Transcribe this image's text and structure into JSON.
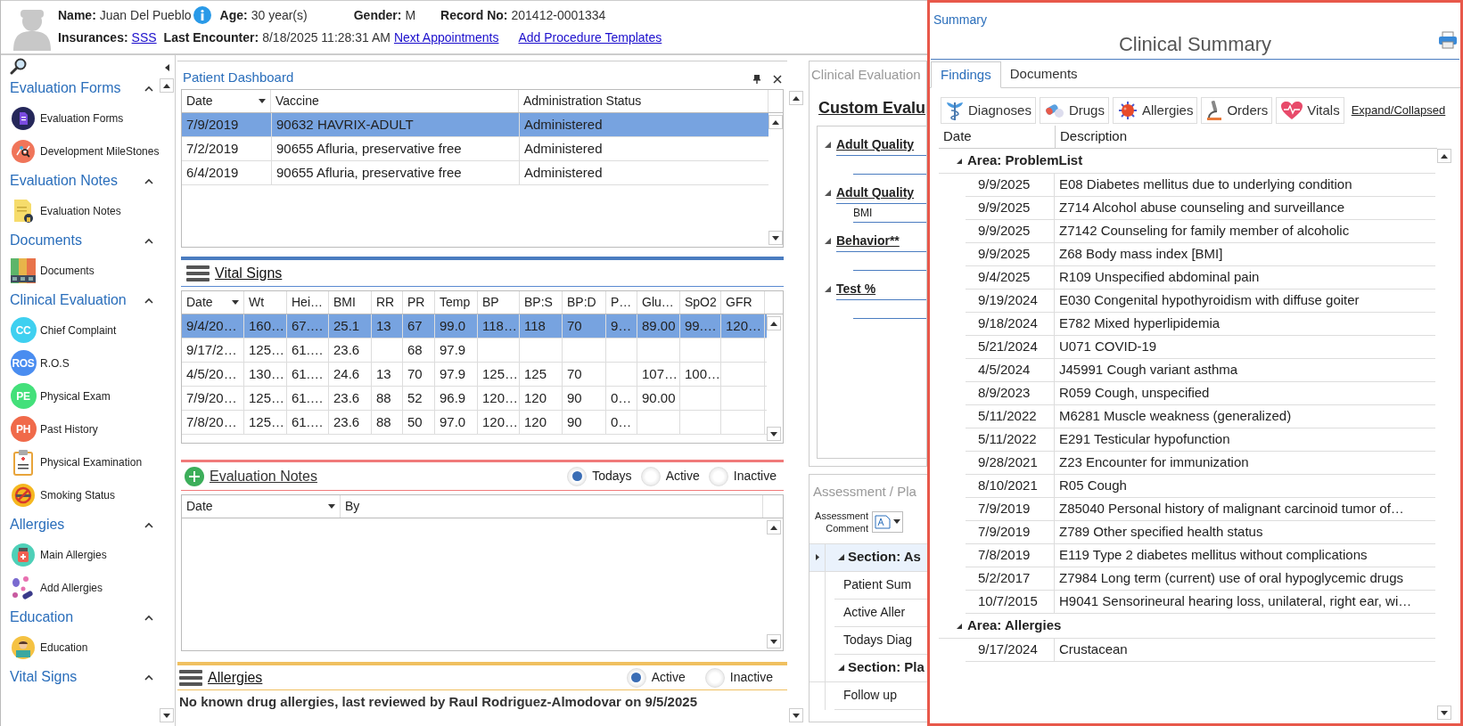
{
  "patient": {
    "row_1": [
      {
        "label": "Name:",
        "value": "Juan Del Pueblo",
        "info": true,
        "link": false
      },
      {
        "label": "Age:",
        "value": "30 year(s)",
        "link": false
      },
      {
        "label": "Gender:",
        "value": "M",
        "link": false
      },
      {
        "label": "Record No:",
        "value": "201412-0001334",
        "link": false
      }
    ],
    "row_2": [
      {
        "label": "Insurances:",
        "value": "SSS",
        "link": true
      },
      {
        "label": "Last Encounter:",
        "value": "8/18/2025 11:28:31 AM",
        "link": false
      }
    ],
    "links": [
      "Next Appointments",
      "Add Procedure Templates"
    ]
  },
  "sidebar": {
    "groups": [
      {
        "title": "Evaluation Forms",
        "expanded": true,
        "items": [
          {
            "label": "Evaluation Forms"
          },
          {
            "label": "Development MileStones"
          }
        ]
      },
      {
        "title": "Evaluation Notes",
        "expanded": true,
        "items": [
          {
            "label": "Evaluation Notes"
          }
        ]
      },
      {
        "title": "Documents",
        "expanded": true,
        "items": [
          {
            "label": "Documents"
          }
        ]
      },
      {
        "title": "Clinical Evaluation",
        "expanded": true,
        "items": [
          {
            "label": "Chief Complaint",
            "badge": "CC"
          },
          {
            "label": "R.O.S",
            "badge": "ROS"
          },
          {
            "label": "Physical Exam",
            "badge": "PE"
          },
          {
            "label": "Past History",
            "badge": "PH"
          },
          {
            "label": "Physical Examination"
          },
          {
            "label": "Smoking Status"
          }
        ]
      },
      {
        "title": "Allergies",
        "expanded": true,
        "items": [
          {
            "label": "Main Allergies"
          },
          {
            "label": "Add Allergies"
          }
        ]
      },
      {
        "title": "Education",
        "expanded": true,
        "items": [
          {
            "label": "Education"
          }
        ]
      },
      {
        "title": "Vital Signs",
        "expanded": true
      }
    ]
  },
  "dashboard": {
    "title": "Patient Dashboard",
    "vaccines": {
      "columns": [
        "Date",
        "Vaccine",
        "Administration Status"
      ],
      "rows": [
        {
          "cells": [
            "7/9/2019",
            "90632 HAVRIX-ADULT",
            "Administered"
          ],
          "selected": true
        },
        {
          "cells": [
            "7/2/2019",
            "90655 Afluria, preservative free",
            "Administered"
          ],
          "selected": false
        },
        {
          "cells": [
            "6/4/2019",
            "90655 Afluria, preservative free",
            "Administered"
          ],
          "selected": false
        }
      ]
    },
    "vital_signs": {
      "title": "Vital Signs",
      "columns": [
        "Date",
        "Wt",
        "Hei…",
        "BMI",
        "RR",
        "PR",
        "Temp",
        "BP",
        "BP:S",
        "BP:D",
        "P…",
        "Glu…",
        "SpO2",
        "GFR"
      ],
      "rows": [
        {
          "cells": [
            "9/4/20…",
            "160…",
            "67.…",
            "25.1",
            "13",
            "67",
            "99.0",
            "118…",
            "118",
            "70",
            "9…",
            "89.00",
            "99.…",
            "120…"
          ],
          "selected": true
        },
        {
          "cells": [
            "9/17/2…",
            "125…",
            "61.…",
            "23.6",
            null,
            "68",
            "97.9",
            null,
            null,
            null,
            null,
            null,
            null,
            null
          ],
          "selected": false
        },
        {
          "cells": [
            "4/5/20…",
            "130…",
            "61.…",
            "24.6",
            "13",
            "70",
            "97.9",
            "125…",
            "125",
            "70",
            null,
            "107…",
            "100…",
            null
          ],
          "selected": false
        },
        {
          "cells": [
            "7/9/20…",
            "125…",
            "61.…",
            "23.6",
            "88",
            "52",
            "96.9",
            "120…",
            "120",
            "90",
            "0…",
            "90.00",
            null,
            null
          ],
          "selected": false
        },
        {
          "cells": [
            "7/8/20…",
            "125…",
            "61.…",
            "23.6",
            "88",
            "50",
            "97.0",
            "120…",
            "120",
            "90",
            "0…",
            null,
            null,
            null
          ],
          "selected": false
        }
      ]
    },
    "evaluation_notes": {
      "title": "Evaluation Notes",
      "columns": [
        "Date",
        "By"
      ],
      "filters": [
        {
          "label": "Todays",
          "selected": true
        },
        {
          "label": "Active",
          "selected": false
        },
        {
          "label": "Inactive",
          "selected": false
        }
      ]
    },
    "allergies": {
      "title": "Allergies",
      "filters": [
        {
          "label": "Active",
          "selected": true
        },
        {
          "label": "Inactive",
          "selected": false
        }
      ],
      "message": "No known drug allergies, last reviewed by Raul Rodriguez-Almodovar on 9/5/2025"
    }
  },
  "clinical_evaluation": {
    "title": "Clinical Evaluation",
    "form_title": "Custom Evalu",
    "sections": [
      {
        "title": "Adult Quality"
      },
      {
        "title": "Adult Quality",
        "items": [
          "BMI"
        ]
      },
      {
        "title": "Behavior**"
      },
      {
        "title": "Test %"
      }
    ]
  },
  "assessment": {
    "title": "Assessment / Pla",
    "comment_label": "Assessment Comment",
    "sections": [
      {
        "title": "Section: As",
        "selected": true,
        "expanded": true,
        "children": [
          "Patient Sum",
          "Active Aller",
          "Todays Diag"
        ]
      },
      {
        "title": "Section: Pla",
        "selected": false,
        "expanded": true,
        "children": [
          "Follow up"
        ]
      }
    ]
  },
  "summary": {
    "panel_title": "Summary",
    "title": "Clinical Summary",
    "tabs": [
      {
        "label": "Findings",
        "selected": true
      },
      {
        "label": "Documents",
        "selected": false
      }
    ],
    "filters": [
      "Diagnoses",
      "Drugs",
      "Allergies",
      "Orders",
      "Vitals"
    ],
    "expand_link": "Expand/Collapsed",
    "columns": [
      "Date",
      "Description"
    ],
    "areas": [
      {
        "title": "Area: ProblemList",
        "expanded": true,
        "rows": [
          {
            "date": "9/9/2025",
            "description": "E08 Diabetes mellitus due to underlying condition"
          },
          {
            "date": "9/9/2025",
            "description": "Z714 Alcohol abuse counseling and surveillance"
          },
          {
            "date": "9/9/2025",
            "description": "Z7142 Counseling for family member of alcoholic"
          },
          {
            "date": "9/9/2025",
            "description": "Z68 Body mass index [BMI]"
          },
          {
            "date": "9/4/2025",
            "description": "R109 Unspecified abdominal pain"
          },
          {
            "date": "9/19/2024",
            "description": "E030 Congenital hypothyroidism with diffuse goiter"
          },
          {
            "date": "9/18/2024",
            "description": "E782 Mixed hyperlipidemia"
          },
          {
            "date": "5/21/2024",
            "description": "U071 COVID-19"
          },
          {
            "date": "4/5/2024",
            "description": "J45991 Cough variant asthma"
          },
          {
            "date": "8/9/2023",
            "description": "R059 Cough, unspecified"
          },
          {
            "date": "5/11/2022",
            "description": "M6281 Muscle weakness (generalized)"
          },
          {
            "date": "5/11/2022",
            "description": "E291 Testicular hypofunction"
          },
          {
            "date": "9/28/2021",
            "description": "Z23 Encounter for immunization"
          },
          {
            "date": "8/10/2021",
            "description": "R05 Cough"
          },
          {
            "date": "7/9/2019",
            "description": "Z85040 Personal history of malignant carcinoid tumor of…"
          },
          {
            "date": "7/9/2019",
            "description": "Z789 Other specified health status"
          },
          {
            "date": "7/8/2019",
            "description": "E119 Type 2 diabetes mellitus without complications"
          },
          {
            "date": "5/2/2017",
            "description": "Z7984 Long term (current) use of oral hypoglycemic drugs"
          },
          {
            "date": "10/7/2015",
            "description": "H9041 Sensorineural hearing loss, unilateral, right ear, wi…"
          }
        ]
      },
      {
        "title": "Area: Allergies",
        "expanded": true,
        "rows": [
          {
            "date": "9/17/2024",
            "description": "Crustacean"
          }
        ]
      }
    ]
  }
}
